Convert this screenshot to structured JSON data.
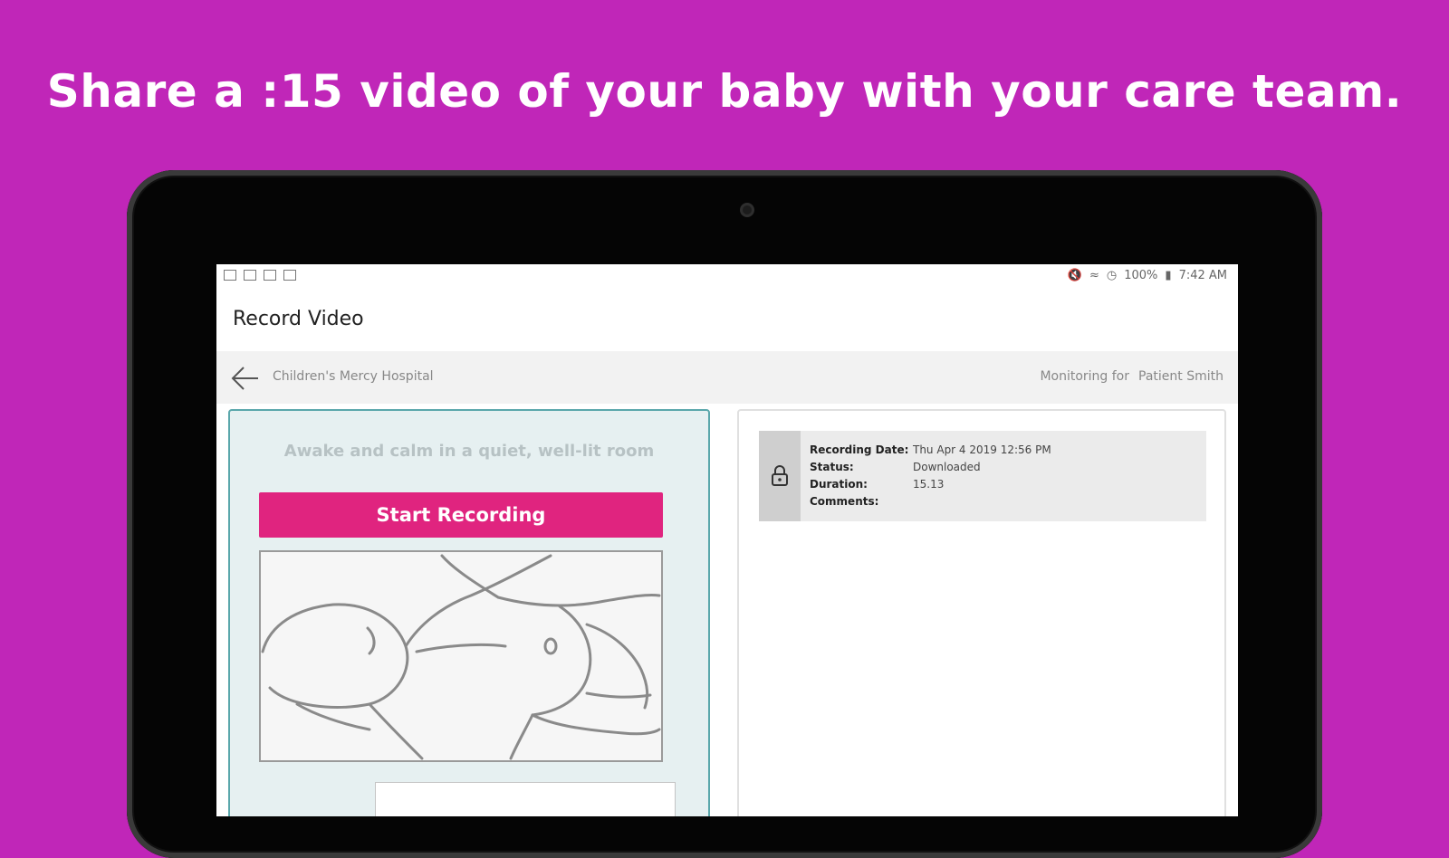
{
  "headline": "Share a :15 video of your baby with your care team.",
  "status_bar": {
    "battery": "100%",
    "time": "7:42 AM"
  },
  "app": {
    "title": "Record Video"
  },
  "subbar": {
    "hospital": "Children's Mercy Hospital",
    "monitoring_label": "Monitoring for",
    "patient": "Patient Smith"
  },
  "record_panel": {
    "hint": "Awake and calm in a quiet, well-lit room",
    "start_label": "Start Recording"
  },
  "recording": {
    "date_label": "Recording Date:",
    "date_value": "Thu Apr 4 2019 12:56 PM",
    "status_label": "Status:",
    "status_value": "Downloaded",
    "duration_label": "Duration:",
    "duration_value": "15.13",
    "comments_label": "Comments:",
    "comments_value": ""
  },
  "colors": {
    "background": "#c026b8",
    "accent": "#e0247f",
    "panel": "#e6f0f1",
    "panel_border": "#5aa7ab"
  },
  "icons": [
    "back-arrow-icon",
    "lock-icon",
    "camera-icon"
  ]
}
